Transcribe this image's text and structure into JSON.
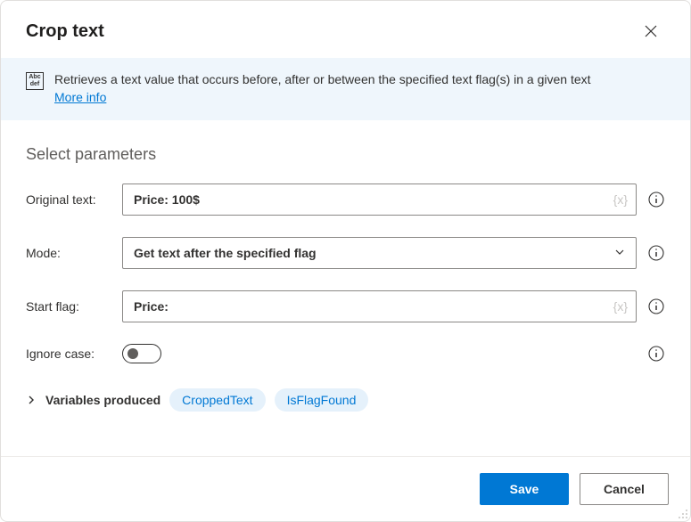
{
  "header": {
    "title": "Crop text"
  },
  "banner": {
    "icon_text": "Abc\ndef",
    "description": "Retrieves a text value that occurs before, after or between the specified text flag(s) in a given text",
    "more_info_label": "More info"
  },
  "section": {
    "title": "Select parameters"
  },
  "params": {
    "original_text": {
      "label": "Original text:",
      "value": "Price: 100$",
      "token": "{x}"
    },
    "mode": {
      "label": "Mode:",
      "value": "Get text after the specified flag"
    },
    "start_flag": {
      "label": "Start flag:",
      "value": "Price:",
      "token": "{x}"
    },
    "ignore_case": {
      "label": "Ignore case:",
      "value": false
    }
  },
  "variables": {
    "label": "Variables produced",
    "items": [
      "CroppedText",
      "IsFlagFound"
    ]
  },
  "footer": {
    "save_label": "Save",
    "cancel_label": "Cancel"
  }
}
